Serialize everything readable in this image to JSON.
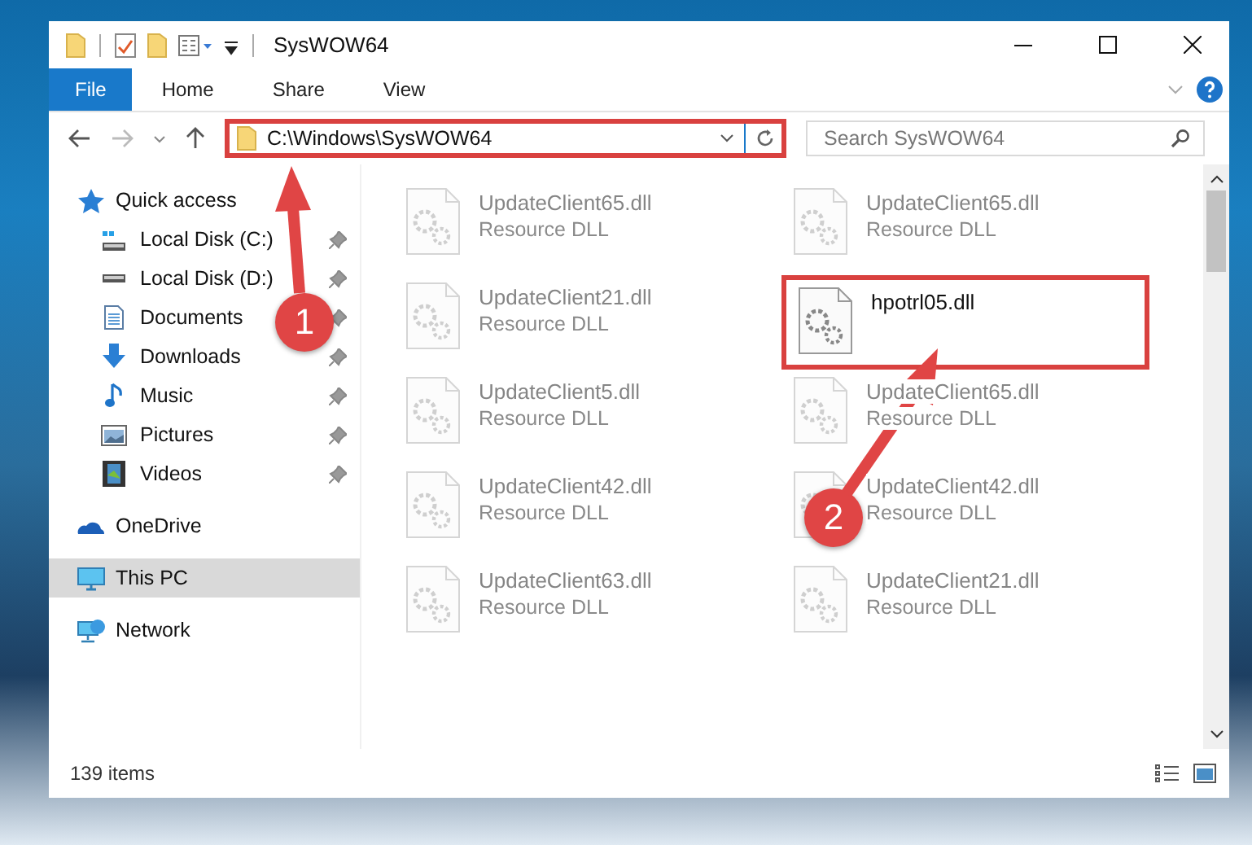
{
  "window": {
    "title": "SysWOW64"
  },
  "ribbon_tabs": [
    {
      "label": "File",
      "selected": true
    },
    {
      "label": "Home",
      "selected": false
    },
    {
      "label": "Share",
      "selected": false
    },
    {
      "label": "View",
      "selected": false
    }
  ],
  "address": {
    "path": "C:\\Windows\\SysWOW64",
    "highlighted": true
  },
  "search": {
    "placeholder": "Search SysWOW64"
  },
  "navigation": [
    {
      "label": "Quick access",
      "kind": "star",
      "selected": false,
      "children": [
        {
          "label": "Local Disk (C:)",
          "kind": "system-drive",
          "pinned": true
        },
        {
          "label": "Local Disk (D:)",
          "kind": "drive",
          "pinned": true
        },
        {
          "label": "Documents",
          "kind": "documents",
          "pinned": true
        },
        {
          "label": "Downloads",
          "kind": "downloads",
          "pinned": true
        },
        {
          "label": "Music",
          "kind": "music",
          "pinned": true
        },
        {
          "label": "Pictures",
          "kind": "pictures",
          "pinned": true
        },
        {
          "label": "Videos",
          "kind": "videos",
          "pinned": true
        }
      ]
    },
    {
      "label": "OneDrive",
      "kind": "cloud",
      "selected": false
    },
    {
      "label": "This PC",
      "kind": "computer",
      "selected": true
    },
    {
      "label": "Network",
      "kind": "network",
      "selected": false
    }
  ],
  "files": [
    {
      "name": "UpdateClient65.dll",
      "type": "Resource DLL",
      "faded": true,
      "highlighted": false
    },
    {
      "name": "UpdateClient65.dll",
      "type": "Resource DLL",
      "faded": true,
      "highlighted": false
    },
    {
      "name": "UpdateClient21.dll",
      "type": "Resource DLL",
      "faded": true,
      "highlighted": false
    },
    {
      "name": "hpotrl05.dll",
      "faded": false,
      "highlighted": true
    },
    {
      "name": "UpdateClient5.dll",
      "type": "Resource DLL",
      "faded": true,
      "highlighted": false
    },
    {
      "name": "UpdateClient65.dll",
      "type": "Resource DLL",
      "faded": true,
      "highlighted": false
    },
    {
      "name": "UpdateClient42.dll",
      "type": "Resource DLL",
      "faded": true,
      "highlighted": false
    },
    {
      "name": "UpdateClient42.dll",
      "type": "Resource DLL",
      "faded": true,
      "highlighted": false
    },
    {
      "name": "UpdateClient63.dll",
      "type": "Resource DLL",
      "faded": true,
      "highlighted": false
    },
    {
      "name": "UpdateClient21.dll",
      "type": "Resource DLL",
      "faded": true,
      "highlighted": false
    }
  ],
  "status_bar": {
    "item_count": "139 items"
  },
  "callouts": [
    {
      "number": "1"
    },
    {
      "number": "2"
    }
  ]
}
